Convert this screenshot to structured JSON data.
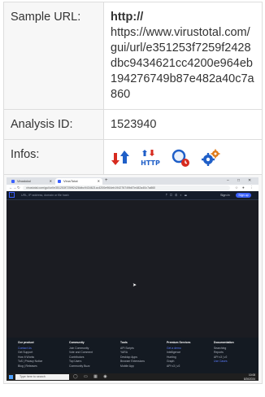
{
  "rows": {
    "sample_url": {
      "key": "Sample URL:",
      "value_head": "http://",
      "value": "https://www.virustotal.com/gui/url/e351253f7259f2428dbc9434621cc4200e964eb194276749b87e482a40c7a860"
    },
    "analysis_id": {
      "key": "Analysis ID:",
      "value": "1523940"
    },
    "infos": {
      "key": "Infos:",
      "icons": [
        "download-upload-arrows-icon",
        "http-icon",
        "magnifier-clock-icon",
        "gears-icon"
      ]
    }
  },
  "screenshot": {
    "tabs": [
      {
        "label": "Virustotal"
      },
      {
        "label": "VirusTotal"
      }
    ],
    "address": "virustotal.com/gui/url/e351253f7259f2428dbc9434621cc4200e964eb194276749b87e482a40c7a860",
    "search_placeholder": "URL, IP address, domain or file hash",
    "sign_in": "Sign in",
    "sign_up": "Sign up",
    "footer_columns": [
      {
        "heading": "Our product",
        "items": [
          "Contact Us",
          "Get Support",
          "How It Works",
          "ToS | Privacy Notice",
          "Blog | Releases"
        ]
      },
      {
        "heading": "Community",
        "items": [
          "Join Community",
          "Vote and Comment",
          "Contributors",
          "Top Users",
          "Community Buzz"
        ]
      },
      {
        "heading": "Tools",
        "items": [
          "API Scripts",
          "YARA",
          "Desktop Apps",
          "Browser Extensions",
          "Mobile App"
        ]
      },
      {
        "heading": "Premium Services",
        "items": [
          "Get a demo",
          "Intelligence",
          "Hunting",
          "Graph",
          "API v3 | v2"
        ]
      },
      {
        "heading": "Documentation",
        "items": [
          "Searching",
          "Reports",
          "API v3 | v2",
          "Use Cases"
        ]
      }
    ],
    "taskbar_search": "Type here to search",
    "clock_time": "10:08",
    "clock_date": "8/26/2024",
    "colors": {
      "accent": "#3b61ff",
      "page_bg": "#1b1c22",
      "footer_bg": "#141a22"
    }
  }
}
